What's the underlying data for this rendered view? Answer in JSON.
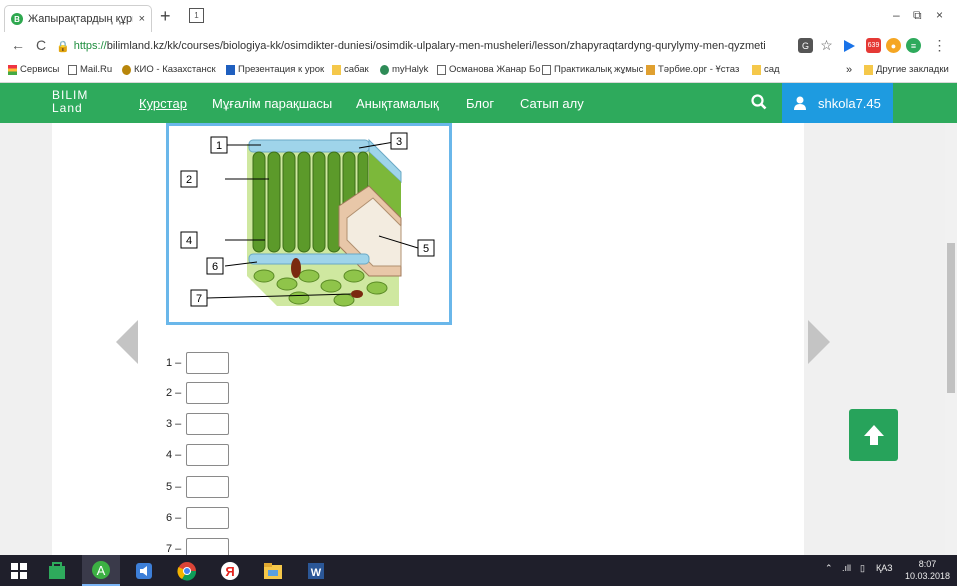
{
  "browser": {
    "tab_title": "Жапырақтардың құрылымы",
    "tab_favicon_letter": "B",
    "tab_close": "×",
    "new_tab": "+",
    "tab_search": "1",
    "window_controls": {
      "minimize": "–",
      "restore": "⧉",
      "close": "×"
    },
    "nav": {
      "back": "←",
      "reload": "C"
    },
    "url_secure_part": "https://",
    "url_host": "bilimland.kz",
    "url_path": "/kk/courses/biologiya-kk/osimdikter-duniesi/osimdik-ulpalary-men-musheleri/lesson/zhapyraqtardyng-qurylymy-men-qyzmeti",
    "extension_badge": "639",
    "bookmarks": [
      "Сервисы",
      "Mail.Ru",
      "КИО - Казахстанск",
      "Презентация к урок",
      "сабак",
      "myHalyk",
      "Османова Жанар Бо",
      "Практикалық жұмыс",
      "Тәрбие.орг - Ұстаз",
      "сад"
    ],
    "bookmarks_more": "»",
    "other_bookmarks": "Другие закладки"
  },
  "site": {
    "logo_line1": "BILIM",
    "logo_line2": "Land",
    "nav": [
      "Курстар",
      "Мұғалім парақшасы",
      "Анықтамалық",
      "Блог",
      "Сатып алу"
    ],
    "username": "shkola7.45"
  },
  "figure": {
    "labels": [
      "1",
      "2",
      "3",
      "4",
      "5",
      "6",
      "7"
    ]
  },
  "answers": [
    {
      "label": "1 –",
      "value": ""
    },
    {
      "label": "2 –",
      "value": ""
    },
    {
      "label": "3 –",
      "value": ""
    },
    {
      "label": "4 –",
      "value": ""
    },
    {
      "label": "5 –",
      "value": ""
    },
    {
      "label": "6 –",
      "value": ""
    },
    {
      "label": "7 –",
      "value": ""
    }
  ],
  "taskbar": {
    "language": "ҚАЗ",
    "time": "8:07",
    "date": "10.03.2018"
  },
  "colors": {
    "site_green": "#2eaa5c",
    "user_blue": "#1e9be0",
    "figure_border": "#6ab7ea",
    "scroll_top_green": "#27a35b"
  }
}
